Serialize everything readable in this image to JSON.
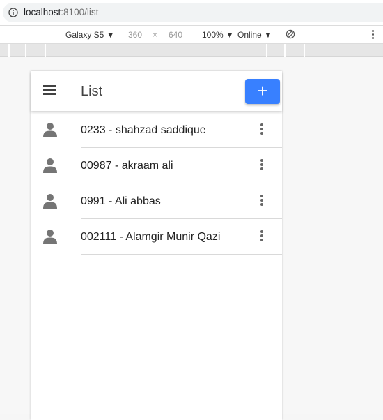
{
  "browser": {
    "url_host": "localhost",
    "url_rest": ":8100/list"
  },
  "devtools": {
    "device": "Galaxy S5 ▼",
    "width": "360",
    "times": "×",
    "height": "640",
    "zoom": "100% ▼",
    "network": "Online ▼",
    "rotate_icon": "rotate-icon",
    "more_icon": "kebab-vertical-icon"
  },
  "app": {
    "title": "List",
    "menu_icon": "menu-icon",
    "add_label": "+",
    "accent": "#3880ff",
    "items": [
      {
        "label": "0233 - shahzad saddique",
        "icon": "person-icon"
      },
      {
        "label": "00987 - akraam ali",
        "icon": "person-icon"
      },
      {
        "label": "0991 - Ali abbas",
        "icon": "person-icon"
      },
      {
        "label": "002111 - Alamgir Munir Qazi",
        "icon": "person-icon"
      }
    ]
  }
}
